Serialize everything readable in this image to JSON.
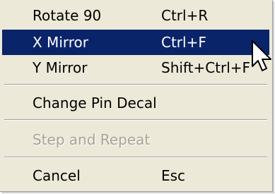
{
  "menu": {
    "items": [
      {
        "label": "Rotate 90",
        "shortcut": "Ctrl+R"
      },
      {
        "label": "X Mirror",
        "shortcut": "Ctrl+F"
      },
      {
        "label": "Y Mirror",
        "shortcut": "Shift+Ctrl+F"
      },
      {
        "label": "Change Pin Decal",
        "shortcut": ""
      },
      {
        "label": "Step and Repeat",
        "shortcut": ""
      },
      {
        "label": "Cancel",
        "shortcut": "Esc"
      }
    ],
    "selected_item": "X Mirror",
    "disabled_item": "Step and Repeat"
  },
  "colors": {
    "menu_background": "#ece9d8",
    "highlight": "#0a246a",
    "highlight_text": "#ffffff",
    "disabled_text": "#a6a39a"
  },
  "icons": {
    "cursor": "arrow-cursor-icon"
  }
}
